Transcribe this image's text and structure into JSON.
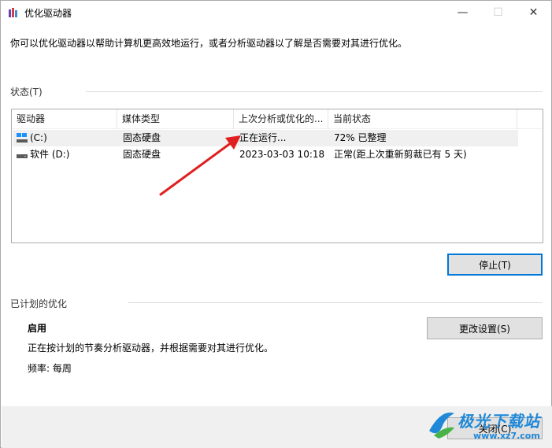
{
  "window": {
    "title": "优化驱动器",
    "minimize_glyph": "—",
    "maximize_glyph": "☐",
    "close_glyph": "✕"
  },
  "intro": "你可以优化驱动器以帮助计算机更高效地运行，或者分析驱动器以了解是否需要对其进行优化。",
  "status_section": {
    "heading": "状态(T)",
    "columns": [
      "驱动器",
      "媒体类型",
      "上次分析或优化的...",
      "当前状态"
    ],
    "rows": [
      {
        "drive": "(C:)",
        "media": "固态硬盘",
        "last": "正在运行...",
        "status": "72% 已整理",
        "icon": "system-drive-icon"
      },
      {
        "drive": "软件 (D:)",
        "media": "固态硬盘",
        "last": "2023-03-03 10:18",
        "status": "正常(距上次重新剪裁已有 5 天)",
        "icon": "drive-icon"
      }
    ],
    "stop_button": "停止(T)"
  },
  "schedule_section": {
    "heading": "已计划的优化",
    "state": "启用",
    "description": "正在按计划的节奏分析驱动器，并根据需要对其进行优化。",
    "frequency": "频率: 每周",
    "change_button": "更改设置(S)"
  },
  "footer": {
    "close_button": "关闭(C)"
  },
  "watermark": {
    "text": "极光下载站",
    "url": "www.xz7.com"
  },
  "colors": {
    "accent": "#0078d7",
    "arrow": "#e02020",
    "watermark": "#1f88d8"
  }
}
